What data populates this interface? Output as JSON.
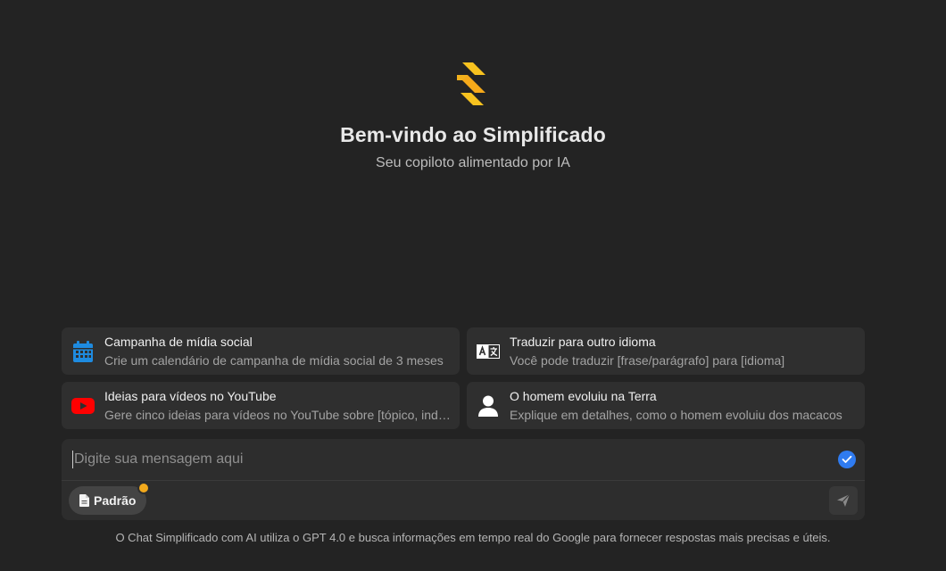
{
  "brand": {
    "title": "Bem-vindo ao Simplificado",
    "subtitle": "Seu copiloto alimentado por IA",
    "logo_icon": "simplificado-logo-icon",
    "accent_color": "#f5b51c"
  },
  "cards": [
    {
      "icon": "calendar-icon",
      "title": "Campanha de mídia social",
      "description": "Crie um calendário de campanha de mídia social de 3 meses"
    },
    {
      "icon": "translate-icon",
      "title": "Traduzir para outro idioma",
      "description": "Você pode traduzir [frase/parágrafo] para [idioma]"
    },
    {
      "icon": "youtube-icon",
      "title": "Ideias para vídeos no YouTube",
      "description": "Gere cinco ideias para vídeos no YouTube sobre [tópico, indústria]"
    },
    {
      "icon": "person-icon",
      "title": "O homem evoluiu na Terra",
      "description": "Explique em detalhes, como o homem evoluiu dos macacos"
    }
  ],
  "composer": {
    "placeholder": "Digite sua mensagem aqui",
    "value": "",
    "mode_label": "Padrão"
  },
  "footer": {
    "disclaimer": "O Chat Simplificado com AI utiliza o GPT 4.0 e busca informações em tempo real do Google para fornecer respostas mais precisas e úteis."
  }
}
